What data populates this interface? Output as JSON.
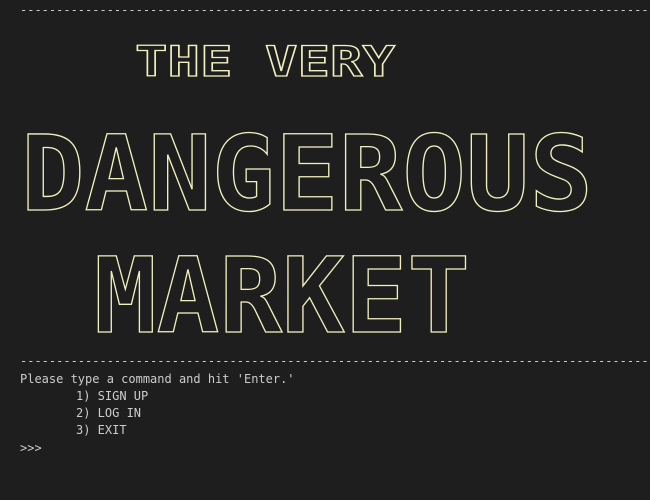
{
  "banner": {
    "title_line_1": "THE VERY",
    "title_line_2": "DANGEROUS",
    "title_line_3": "MARKET",
    "text_color": "#f0f0bd"
  },
  "divider": {
    "top_text": "----------------------------------------------------------------------------------------------------",
    "bottom_text": "----------------------------------------------------------------------------------------------------"
  },
  "instructions": "Please type a command and hit 'Enter.'",
  "menu": {
    "items": [
      {
        "label": "1) SIGN UP"
      },
      {
        "label": "2) LOG IN"
      },
      {
        "label": "3) EXIT"
      }
    ]
  },
  "input": {
    "prompt": ">>>",
    "value": ""
  },
  "colors": {
    "background": "#1e1e1e",
    "text": "#cccccc"
  }
}
